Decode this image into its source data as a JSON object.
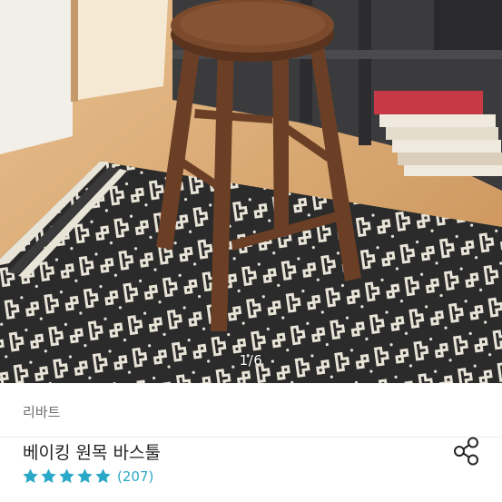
{
  "gallery": {
    "counter": "1/6"
  },
  "product": {
    "seller": "리바트",
    "title": "베이킹 원목 바스툴",
    "rating_count": "(207)",
    "stars": 5
  },
  "icons": {
    "share": "share-icon",
    "star": "star-icon"
  },
  "colors": {
    "star": "#2aa8c7",
    "count": "#2aa8c7"
  }
}
